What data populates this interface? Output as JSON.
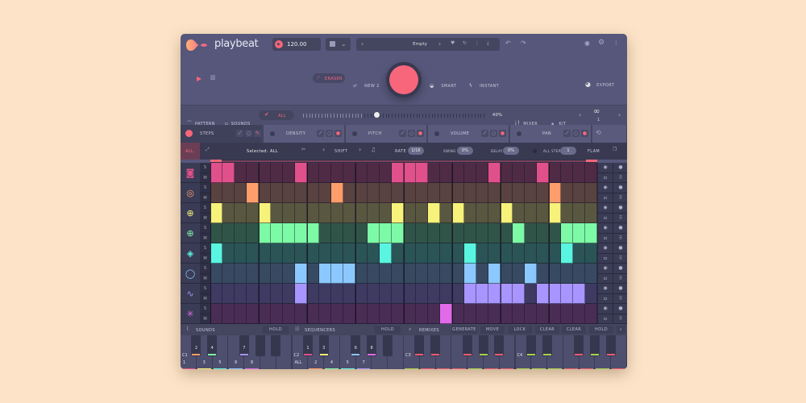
{
  "app": {
    "name": "playbeat"
  },
  "header": {
    "bpm": "120.00",
    "pattern_name": "Empty"
  },
  "controls": {
    "eraser": "ERASER",
    "new": "NEW 2",
    "smart": "SMART",
    "instant": "INSTANT",
    "export": "EXPORT"
  },
  "toolbar": {
    "pattern": "PATTERN",
    "sounds": "SOUNDS",
    "all": "ALL",
    "slider_percent": "40%",
    "slider_value": 40,
    "mixer": "MIXER",
    "kit": "KIT",
    "kit_number": "1"
  },
  "tabs": [
    {
      "label": "STEPS"
    },
    {
      "label": "DENSITY"
    },
    {
      "label": "PITCH"
    },
    {
      "label": "VOLUME"
    },
    {
      "label": "PAN"
    }
  ],
  "stepbar": {
    "all": "ALL",
    "selected": "Selected: ALL",
    "shift": "SHIFT",
    "rate_label": "RATE",
    "rate": "1/16",
    "swing_label": "SWING",
    "swing": "0%",
    "delay_label": "DELAY",
    "delay": "0%",
    "all_steps_label": "ALL STEPS",
    "all_steps": "1",
    "flam": "FLAM"
  },
  "grid": {
    "steps": 32,
    "solo_label": "S",
    "mute_label": "M",
    "tracks": [
      {
        "icon": "kick-drum-icon",
        "glyph": "◙",
        "on": "#e0508a",
        "off": "#4f2b46",
        "active": [
          0,
          1,
          7,
          15,
          16,
          17,
          23,
          27
        ]
      },
      {
        "icon": "snare-drum-icon",
        "glyph": "◎",
        "on": "#ff9e6b",
        "off": "#594240",
        "active": [
          3,
          10,
          28
        ]
      },
      {
        "icon": "hihat-closed-icon",
        "glyph": "⊕",
        "on": "#f7f27a",
        "off": "#595740",
        "active": [
          0,
          4,
          15,
          18,
          20,
          24,
          28
        ]
      },
      {
        "icon": "hihat-open-icon",
        "glyph": "⊕",
        "on": "#7dfaa6",
        "off": "#305548",
        "active": [
          4,
          5,
          6,
          7,
          8,
          13,
          14,
          15,
          25,
          29,
          30,
          31
        ]
      },
      {
        "icon": "clap-icon",
        "glyph": "◈",
        "on": "#5af5e0",
        "off": "#2b5457",
        "active": [
          0,
          14,
          21,
          29
        ]
      },
      {
        "icon": "tambourine-icon",
        "glyph": "◯",
        "on": "#8ac8ff",
        "off": "#384a62",
        "active": [
          7,
          9,
          10,
          11,
          21,
          23,
          26
        ]
      },
      {
        "icon": "synth-wave-icon",
        "glyph": "∿",
        "on": "#a895ff",
        "off": "#3e3a62",
        "active": [
          7,
          21,
          22,
          23,
          24,
          25,
          27,
          28,
          29,
          30
        ]
      },
      {
        "icon": "sparkle-fx-icon",
        "glyph": "✳",
        "on": "#e06ae8",
        "off": "#4a2d55",
        "active": [
          19
        ]
      }
    ]
  },
  "bottom": {
    "sounds": "SOUNDS",
    "hold1": "HOLD",
    "sequencers": "SEQUENCERS",
    "hold2": "HOLD",
    "remixes": "REMIXES",
    "generate": "GENERATE",
    "move": "MOVE",
    "lock": "LOCK",
    "clear": "CLEAR",
    "clear_all": "CLEAR ALL",
    "hold3": "HOLD"
  },
  "piano": {
    "octaves": [
      {
        "name": "C1",
        "sub": "1",
        "white": [
          {
            "l": "",
            "c": "#e0508a"
          },
          {
            "l": "3",
            "c": "#f7f27a"
          },
          {
            "l": "5",
            "c": "#5af5e0"
          },
          {
            "l": "6",
            "c": "#8ac8ff"
          },
          {
            "l": "8",
            "c": "#e06ae8"
          },
          {
            "l": "",
            "c": ""
          },
          {
            "l": "",
            "c": ""
          }
        ],
        "black": [
          {
            "l": "2",
            "c": "#ff9e6b"
          },
          {
            "l": "4",
            "c": "#7dfaa6"
          },
          {
            "l": "7",
            "c": "#a895ff"
          },
          {
            "l": "",
            "c": ""
          },
          {
            "l": "",
            "c": ""
          }
        ]
      },
      {
        "name": "C2",
        "sub": "ALL",
        "white": [
          {
            "l": "",
            "c": ""
          },
          {
            "l": "2",
            "c": "#ff9e6b"
          },
          {
            "l": "4",
            "c": "#7dfaa6"
          },
          {
            "l": "5",
            "c": "#5af5e0"
          },
          {
            "l": "7",
            "c": "#a895ff"
          },
          {
            "l": "",
            "c": ""
          },
          {
            "l": "",
            "c": ""
          }
        ],
        "black": [
          {
            "l": "1",
            "c": "#e0508a"
          },
          {
            "l": "3",
            "c": "#f7f27a"
          },
          {
            "l": "6",
            "c": "#8ac8ff"
          },
          {
            "l": "8",
            "c": "#e06ae8"
          },
          {
            "l": "",
            "c": ""
          }
        ]
      },
      {
        "name": "C3",
        "sub": "",
        "white": [
          {
            "l": "",
            "c": "#a5d24a"
          },
          {
            "l": "",
            "c": "#ef5a6f"
          },
          {
            "l": "",
            "c": "#ef5a6f"
          },
          {
            "l": "",
            "c": "#ef5a6f"
          },
          {
            "l": "",
            "c": "#a5d24a"
          },
          {
            "l": "",
            "c": "#ef5a6f"
          },
          {
            "l": "",
            "c": "#ef5a6f"
          }
        ],
        "black": [
          {
            "l": "",
            "c": "#ef5a6f"
          },
          {
            "l": "",
            "c": "#ef5a6f"
          },
          {
            "l": "",
            "c": "#ef5a6f"
          },
          {
            "l": "",
            "c": "#a5d24a"
          },
          {
            "l": "",
            "c": "#ef5a6f"
          }
        ]
      },
      {
        "name": "C4",
        "sub": "",
        "white": [
          {
            "l": "",
            "c": "#a5d24a"
          },
          {
            "l": "",
            "c": "#a5d24a"
          },
          {
            "l": "",
            "c": "#a5d24a"
          },
          {
            "l": "",
            "c": "#ef5a6f"
          },
          {
            "l": "",
            "c": "#ef5a6f"
          },
          {
            "l": "",
            "c": "#a5d24a"
          },
          {
            "l": "",
            "c": "#ef5a6f"
          }
        ],
        "black": [
          {
            "l": "",
            "c": "#a5d24a"
          },
          {
            "l": "",
            "c": "#a5d24a"
          },
          {
            "l": "",
            "c": "#ef5a6f"
          },
          {
            "l": "",
            "c": "#a5d24a"
          },
          {
            "l": "",
            "c": "#ef5a6f"
          }
        ]
      }
    ]
  },
  "colors": {
    "accent": "#f7667a",
    "background": "#fde4c8",
    "panel": "#56577a"
  }
}
